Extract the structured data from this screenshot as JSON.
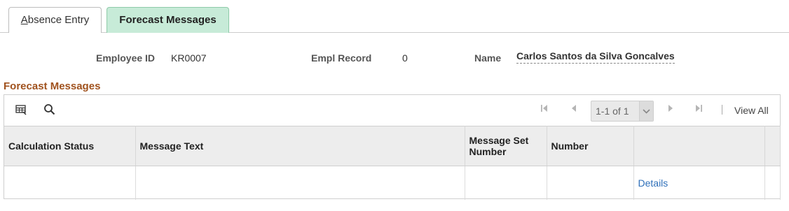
{
  "tabs": [
    {
      "label_prefix": "",
      "label_accel": "A",
      "label_rest": "bsence Entry"
    },
    {
      "label": "Forecast Messages"
    }
  ],
  "header": {
    "employee_id_label": "Employee ID",
    "employee_id": "KR0007",
    "empl_record_label": "Empl Record",
    "empl_record": "0",
    "name_label": "Name",
    "name": "Carlos Santos da Silva Goncalves"
  },
  "section": {
    "title": "Forecast Messages"
  },
  "grid": {
    "pager_text": "1-1 of 1",
    "view_all": "View All",
    "columns": [
      "Calculation Status",
      "Message Text",
      "Message Set Number",
      "Number",
      ""
    ],
    "rows": [
      {
        "calculation_status": "",
        "message_text": "",
        "message_set_number": "",
        "number": "",
        "details": "Details"
      }
    ]
  },
  "colors": {
    "active_tab_bg": "#c7ebd8",
    "section_title": "#a0521e",
    "link": "#2e6fb9"
  }
}
